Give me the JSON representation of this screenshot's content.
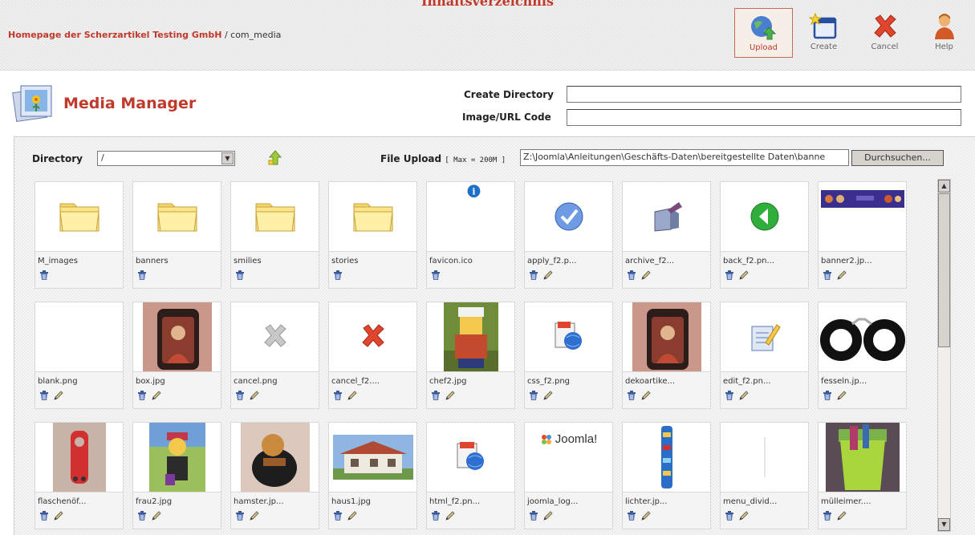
{
  "header": {
    "section_title": "Inhaltsverzeichnis",
    "breadcrumb_home": "Homepage der Scherzartikel Testing GmbH",
    "breadcrumb_path": "/ com_media"
  },
  "toolbar": {
    "upload": "Upload",
    "create": "Create",
    "cancel": "Cancel",
    "help": "Help"
  },
  "page": {
    "title": "Media Manager",
    "create_directory_label": "Create Directory",
    "create_directory_value": "",
    "image_url_label": "Image/URL Code",
    "image_url_value": ""
  },
  "controls": {
    "directory_label": "Directory",
    "directory_value": "/",
    "file_upload_label": "File Upload",
    "file_upload_max": "[ Max = 200M ]",
    "file_path": "Z:\\Joomla\\Anleitungen\\Geschäfts-Daten\\bereitgestellte Daten\\banne",
    "browse_label": "Durchsuchen..."
  },
  "items": [
    {
      "name": "M_images",
      "kind": "folder"
    },
    {
      "name": "banners",
      "kind": "folder"
    },
    {
      "name": "smilies",
      "kind": "folder"
    },
    {
      "name": "stories",
      "kind": "folder"
    },
    {
      "name": "favicon.ico",
      "kind": "favicon"
    },
    {
      "name": "apply_f2.p...",
      "kind": "apply"
    },
    {
      "name": "archive_f2...",
      "kind": "archive"
    },
    {
      "name": "back_f2.pn...",
      "kind": "back"
    },
    {
      "name": "banner2.jp...",
      "kind": "banner"
    },
    {
      "name": "blank.png",
      "kind": "blank"
    },
    {
      "name": "box.jpg",
      "kind": "photo-box"
    },
    {
      "name": "cancel.png",
      "kind": "cancel-grey"
    },
    {
      "name": "cancel_f2....",
      "kind": "cancel-red"
    },
    {
      "name": "chef2.jpg",
      "kind": "photo-chef"
    },
    {
      "name": "css_f2.png",
      "kind": "css"
    },
    {
      "name": "dekoartike...",
      "kind": "photo-box"
    },
    {
      "name": "edit_f2.pn...",
      "kind": "edit"
    },
    {
      "name": "fesseln.jp...",
      "kind": "photo-cuffs"
    },
    {
      "name": "flaschenöf...",
      "kind": "photo-opener"
    },
    {
      "name": "frau2.jpg",
      "kind": "photo-frau"
    },
    {
      "name": "hamster.jp...",
      "kind": "photo-hamster"
    },
    {
      "name": "haus1.jpg",
      "kind": "photo-haus"
    },
    {
      "name": "html_f2.pn...",
      "kind": "html"
    },
    {
      "name": "joomla_log...",
      "kind": "joomla"
    },
    {
      "name": "lichter.jp...",
      "kind": "photo-lichter"
    },
    {
      "name": "menu_divid...",
      "kind": "divider"
    },
    {
      "name": "mülleimer....",
      "kind": "photo-bin"
    }
  ],
  "joomla_logo_text": "Joomla!",
  "colors": {
    "accent": "#c0392b"
  }
}
